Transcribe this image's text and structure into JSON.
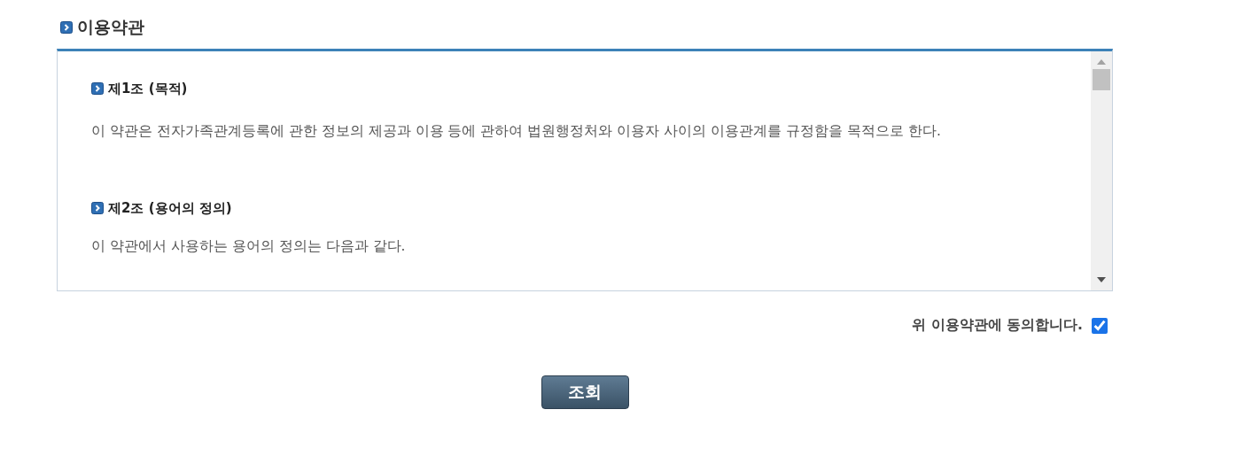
{
  "section_title": "이용약관",
  "articles": [
    {
      "heading": "제1조 (목적)",
      "body": "이 약관은 전자가족관계등록에 관한 정보의 제공과 이용 등에 관하여 법원행정처와 이용자 사이의 이용관계를 규정함을 목적으로 한다."
    },
    {
      "heading": "제2조 (용어의 정의)",
      "body": "이 약관에서 사용하는 용어의 정의는 다음과 같다."
    }
  ],
  "agree": {
    "label": "위 이용약관에 동의합니다.",
    "checked": true
  },
  "submit_button": "조회"
}
